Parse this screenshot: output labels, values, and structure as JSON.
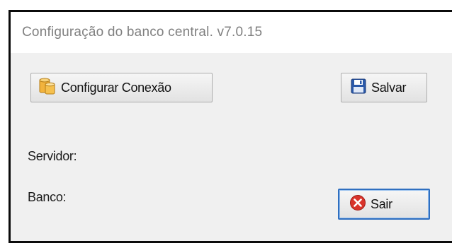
{
  "window": {
    "title": "Configuração do banco central.  v7.0.15"
  },
  "buttons": {
    "configurar": {
      "label": "Configurar Conexão",
      "icon": "database-icon"
    },
    "salvar": {
      "label": "Salvar",
      "icon": "floppy-disk-icon"
    },
    "sair": {
      "label": "Sair",
      "icon": "close-icon"
    }
  },
  "fields": {
    "servidor_label": "Servidor:",
    "banco_label": "Banco:"
  },
  "colors": {
    "window_bg": "#f0f0f0",
    "titlebar_bg": "#ffffff",
    "title_text": "#808080",
    "focus_border": "#2f6fc0",
    "close_icon": "#d9342b",
    "db_icon": "#f2b33d",
    "save_icon": "#2a58a8"
  }
}
